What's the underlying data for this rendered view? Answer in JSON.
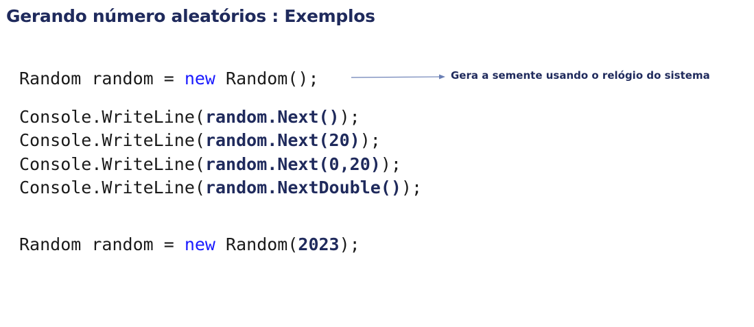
{
  "slide": {
    "title": "Gerando número aleatórios : Exemplos"
  },
  "code": {
    "line1": {
      "prefix": "Random random = ",
      "keyword": "new",
      "suffix": " Random();"
    },
    "line2": {
      "prefix": "Console.WriteLine(",
      "highlight": "random.Next()",
      "suffix": ");"
    },
    "line3": {
      "prefix": "Console.WriteLine(",
      "highlight": "random.Next(20)",
      "suffix": ");"
    },
    "line4": {
      "prefix": "Console.WriteLine(",
      "highlight": "random.Next(0,20)",
      "suffix": ");"
    },
    "line5": {
      "prefix": "Console.WriteLine(",
      "highlight": "random.NextDouble()",
      "suffix": ");"
    },
    "line6": {
      "prefix": "Random random = ",
      "keyword": "new",
      "middle": " Random(",
      "highlight": "2023",
      "suffix": ");"
    }
  },
  "annotation": {
    "text": "Gera a semente usando o relógio do sistema",
    "arrow_color": "#6a7fb5"
  },
  "colors": {
    "title": "#1f2a5c",
    "keyword": "#1a1aff",
    "highlight": "#1f2a5c",
    "code_text": "#1a1a1a"
  }
}
